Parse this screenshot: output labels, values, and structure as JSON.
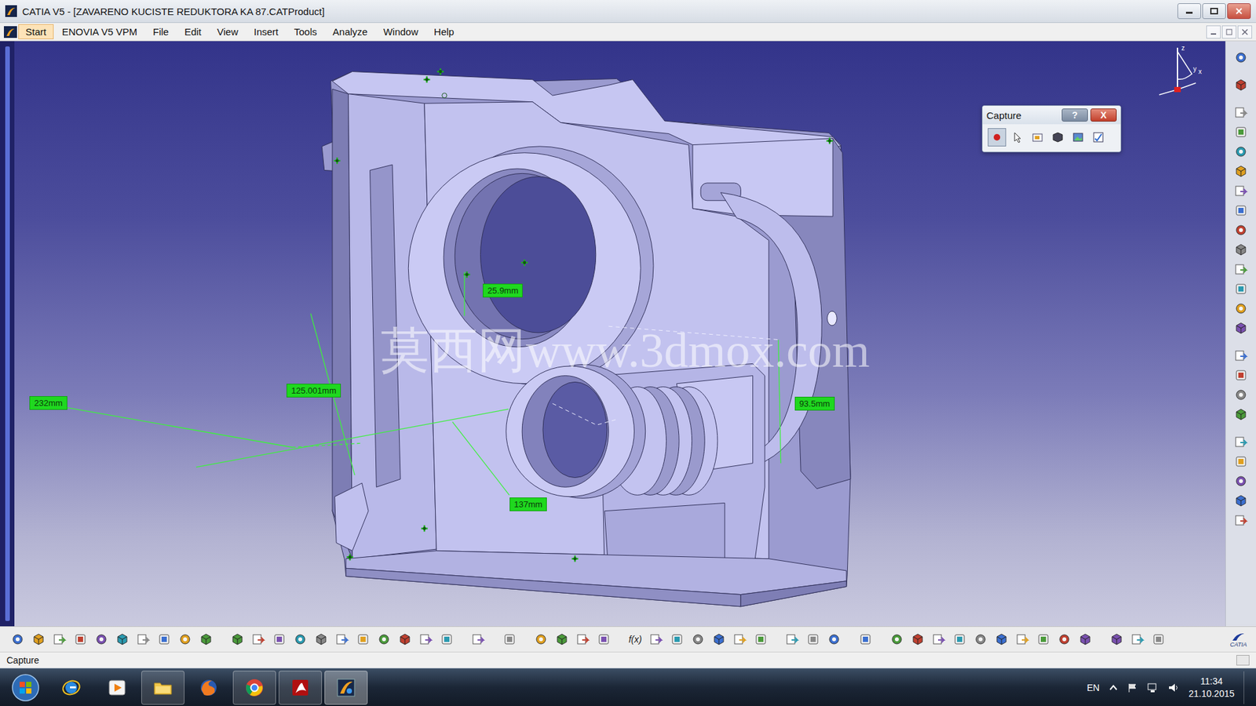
{
  "window": {
    "title": "CATIA V5 - [ZAVARENO KUCISTE REDUKTORA KA 87.CATProduct]"
  },
  "menu": [
    {
      "label": "Start",
      "selected": true
    },
    {
      "label": "ENOVIA V5 VPM",
      "selected": false
    },
    {
      "label": "File",
      "selected": false
    },
    {
      "label": "Edit",
      "selected": false
    },
    {
      "label": "View",
      "selected": false
    },
    {
      "label": "Insert",
      "selected": false
    },
    {
      "label": "Tools",
      "selected": false
    },
    {
      "label": "Analyze",
      "selected": false
    },
    {
      "label": "Window",
      "selected": false
    },
    {
      "label": "Help",
      "selected": false
    }
  ],
  "compass": {
    "axes": [
      "z",
      "y",
      "x"
    ]
  },
  "capture_panel": {
    "title": "Capture",
    "help": "?",
    "close": "X"
  },
  "measurements": [
    "25.9mm",
    "232mm",
    "125.001mm",
    "137mm",
    "93.5mm"
  ],
  "watermark": "莫西网www.3dmox.com",
  "bottom_toolbar": {
    "formula_glyph": "f(x)",
    "logo_text": "CATIA"
  },
  "status_bar": {
    "text": "Capture"
  },
  "taskbar": {
    "apps": [
      {
        "running": false,
        "selected": false
      },
      {
        "running": false,
        "selected": false
      },
      {
        "running": true,
        "selected": false
      },
      {
        "running": false,
        "selected": false
      },
      {
        "running": true,
        "selected": false
      },
      {
        "running": true,
        "selected": false
      },
      {
        "running": true,
        "selected": true
      }
    ],
    "language": "EN",
    "time": "11:34",
    "date": "21.10.2015"
  }
}
